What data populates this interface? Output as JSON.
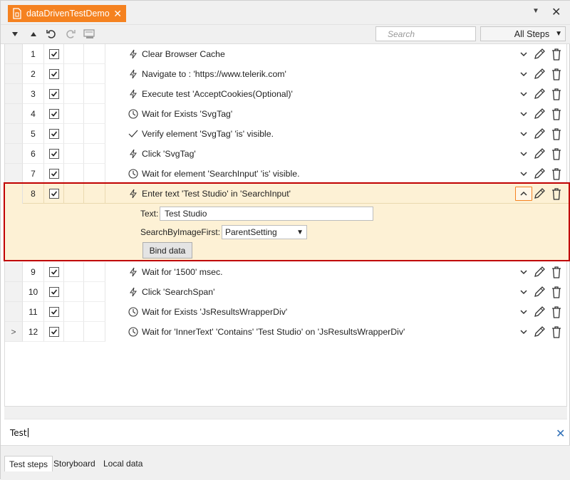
{
  "document_tab": {
    "title": "dataDrivenTestDemo",
    "close_glyph": "✕"
  },
  "window_controls": {
    "dropdown_glyph": "▼",
    "close_glyph": "✕"
  },
  "toolbar": {
    "search_placeholder": "Search",
    "filter_value": "All Steps",
    "icons": [
      "move-down-icon",
      "move-up-icon",
      "undo-icon",
      "redo-icon",
      "recorder-icon"
    ]
  },
  "steps": [
    {
      "num": "1",
      "icon": "lightning",
      "text": "Clear Browser Cache"
    },
    {
      "num": "2",
      "icon": "lightning",
      "text": "Navigate to : 'https://www.telerik.com'"
    },
    {
      "num": "3",
      "icon": "lightning",
      "text": "Execute test 'AcceptCookies(Optional)'"
    },
    {
      "num": "4",
      "icon": "clock",
      "text": "Wait for Exists 'SvgTag'"
    },
    {
      "num": "5",
      "icon": "check",
      "text": "Verify element 'SvgTag' 'is' visible."
    },
    {
      "num": "6",
      "icon": "lightning",
      "text": "Click 'SvgTag'"
    },
    {
      "num": "7",
      "icon": "clock",
      "text": "Wait for element 'SearchInput' 'is' visible."
    },
    {
      "num": "8",
      "icon": "lightning",
      "text": "Enter text 'Test Studio' in 'SearchInput'"
    },
    {
      "num": "9",
      "icon": "lightning",
      "text": "Wait for '1500' msec."
    },
    {
      "num": "10",
      "icon": "lightning",
      "text": "Click 'SearchSpan'"
    },
    {
      "num": "11",
      "icon": "clock",
      "text": "Wait for Exists 'JsResultsWrapperDiv'"
    },
    {
      "num": "12",
      "icon": "clock",
      "text": "Wait for 'InnerText' 'Contains' 'Test Studio' on 'JsResultsWrapperDiv'"
    }
  ],
  "expanded_step": {
    "text_label": "Text:",
    "text_value": "Test Studio",
    "image_label": "SearchByImageFirst:",
    "image_value": "ParentSetting",
    "bind_button": "Bind data"
  },
  "last_row_expander": ">",
  "command_input": {
    "value": "Test",
    "clear_glyph": "✕"
  },
  "bottom_tabs": [
    "Test steps",
    "Storyboard",
    "Local data"
  ],
  "colors": {
    "accent": "#f58220",
    "highlight_bg": "#fdf1d5",
    "highlight_border": "#c00000",
    "link_blue": "#2f6fb7"
  }
}
